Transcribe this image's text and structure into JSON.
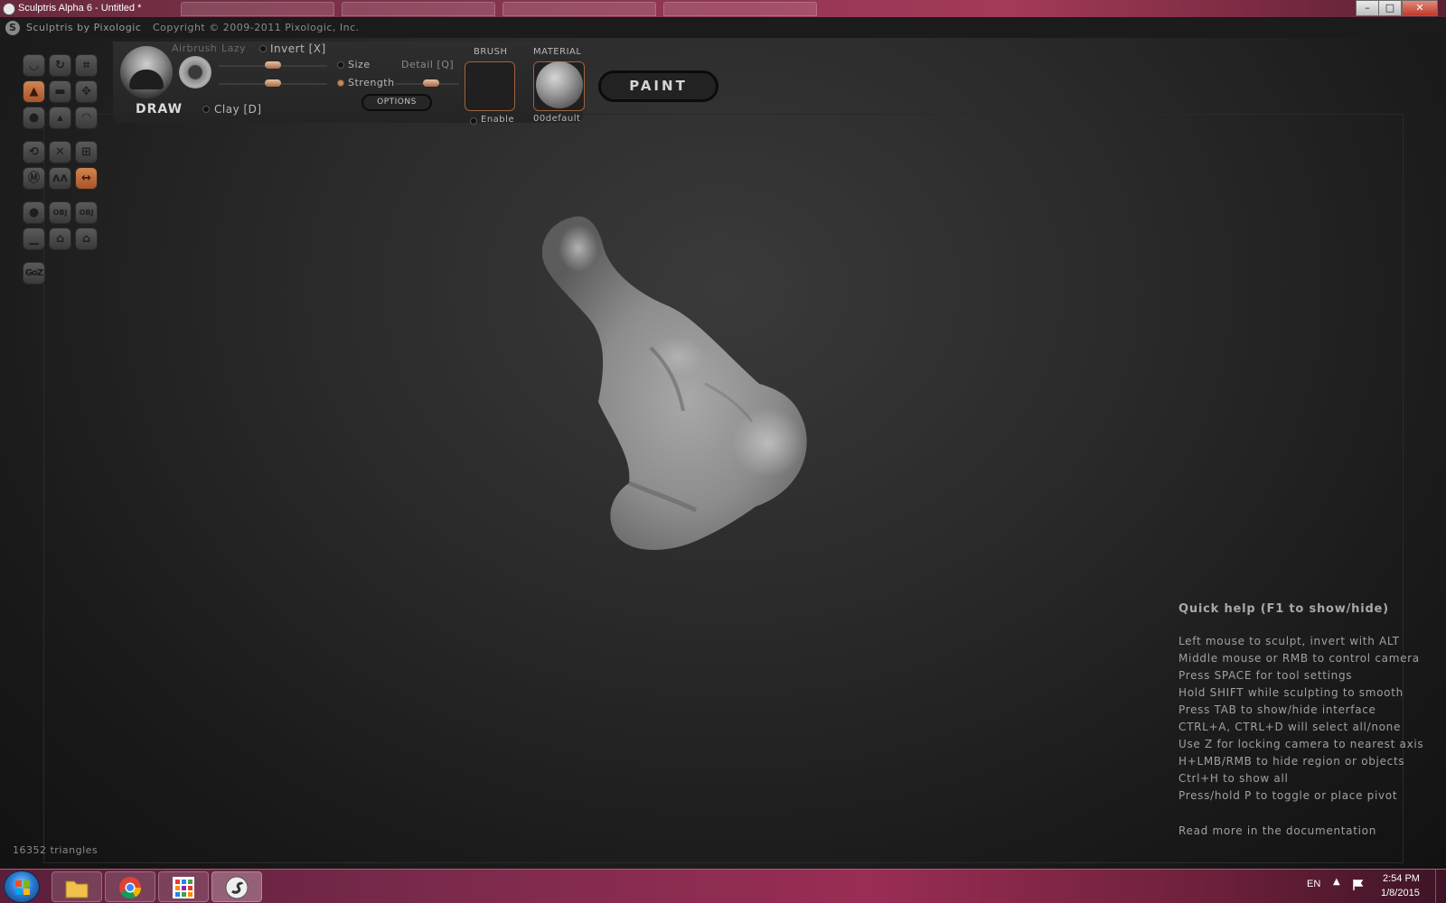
{
  "window": {
    "title": "Sculptris Alpha 6 - Untitled *",
    "buttons": {
      "minimize": "–",
      "maximize": "□",
      "close": "✕"
    }
  },
  "app_header": {
    "brand": "Sculptris by Pixologic",
    "copyright": "Copyright © 2009-2011 Pixologic, Inc."
  },
  "tools": {
    "goz_label": "GoZ",
    "obj_label": "OBJ",
    "active_color": "#c0703e"
  },
  "brush_panel": {
    "tool_name": "DRAW",
    "airbrush_label": "Airbrush",
    "lazy_label": "Lazy",
    "invert_label": "Invert [X]",
    "size_label": "Size",
    "strength_label": "Strength",
    "detail_label": "Detail [Q]",
    "clay_label": "Clay [D]",
    "options_label": "OPTIONS",
    "brush_header": "BRUSH",
    "brush_enable_label": "Enable",
    "material_header": "MATERIAL",
    "material_name": "00default",
    "paint_label": "PAINT"
  },
  "quick_help": {
    "title": "Quick help (F1 to show/hide)",
    "lines": [
      "Left mouse to sculpt, invert with ALT",
      "Middle mouse or RMB to control camera",
      "Press SPACE for tool settings",
      "Hold SHIFT while sculpting to smooth",
      "Press TAB to show/hide interface",
      "CTRL+A, CTRL+D will select all/none",
      "Use Z for locking camera to nearest axis",
      "H+LMB/RMB to hide region or objects",
      "Ctrl+H to show all",
      "Press/hold P to toggle or place pivot"
    ],
    "more": "Read more in the documentation"
  },
  "status": {
    "triangles": "16352 triangles"
  },
  "taskbar": {
    "language": "EN",
    "time": "2:54 PM",
    "date": "1/8/2015"
  }
}
